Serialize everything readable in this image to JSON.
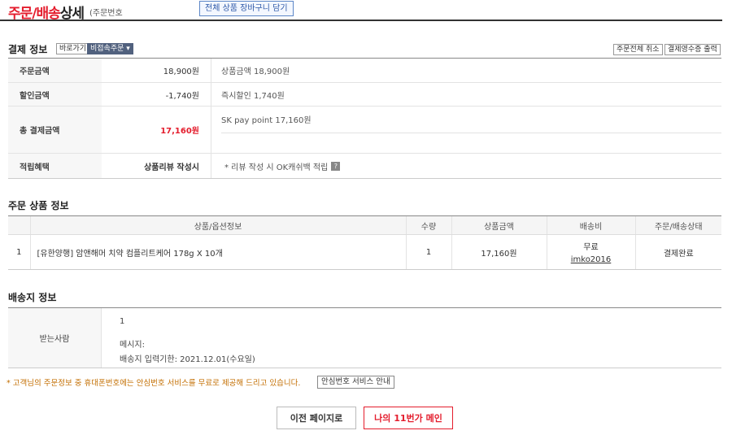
{
  "header": {
    "title_red": "주문/배송",
    "title_black": "상세",
    "order_no_label": "(주문번호",
    "cart_button": "전체 상품 장바구니 담기"
  },
  "payment": {
    "title": "결제 정보",
    "btn_shortcut": "바로가기",
    "btn_split": "비접속주문 ▾",
    "btn_cancel_all": "주문전체 취소",
    "btn_receipt": "결제영수증 출력",
    "rows": {
      "order_amount": {
        "label": "주문금액",
        "value": "18,900원",
        "desc": "상품금액 18,900원"
      },
      "discount": {
        "label": "할인금액",
        "value": "-1,740원",
        "desc": "즉시할인 1,740원"
      },
      "total": {
        "label": "총 결제금액",
        "value": "17,160원",
        "desc": "SK pay point 17,160원"
      },
      "reward": {
        "label": "적립혜택",
        "value": "상품리뷰 작성시",
        "desc": "* 리뷰 작성 시 OK캐쉬백 적립",
        "help": "?"
      }
    }
  },
  "products": {
    "title": "주문 상품 정보",
    "headers": [
      "상품/옵션정보",
      "수량",
      "상품금액",
      "배송비",
      "주문/배송상태"
    ],
    "rows": [
      {
        "index": "1",
        "name": "[유한양행] 암앤해머 치약 컴플리트케어 178g X 10개",
        "qty": "1",
        "price": "17,160원",
        "ship_fee": "무료",
        "seller": "imko2016",
        "status": "결제완료"
      }
    ]
  },
  "delivery": {
    "title": "배송지 정보",
    "receiver_label": "받는사람",
    "receiver_value": "1",
    "message_label": "메시지:",
    "deadline": "배송지 입력기한: 2021.12.01(수요일)"
  },
  "notice": {
    "text": "* 고객님의 주문정보 중 휴대폰번호에는 안심번호 서비스를 무료로 제공해 드리고 있습니다.",
    "button": "안심번호 서비스 안내"
  },
  "footer": {
    "prev_button": "이전 페이지로",
    "main_button": "나의 11번가 메인"
  },
  "colors": {
    "accent_red": "#e41d2d",
    "notice_orange": "#c36e00"
  }
}
